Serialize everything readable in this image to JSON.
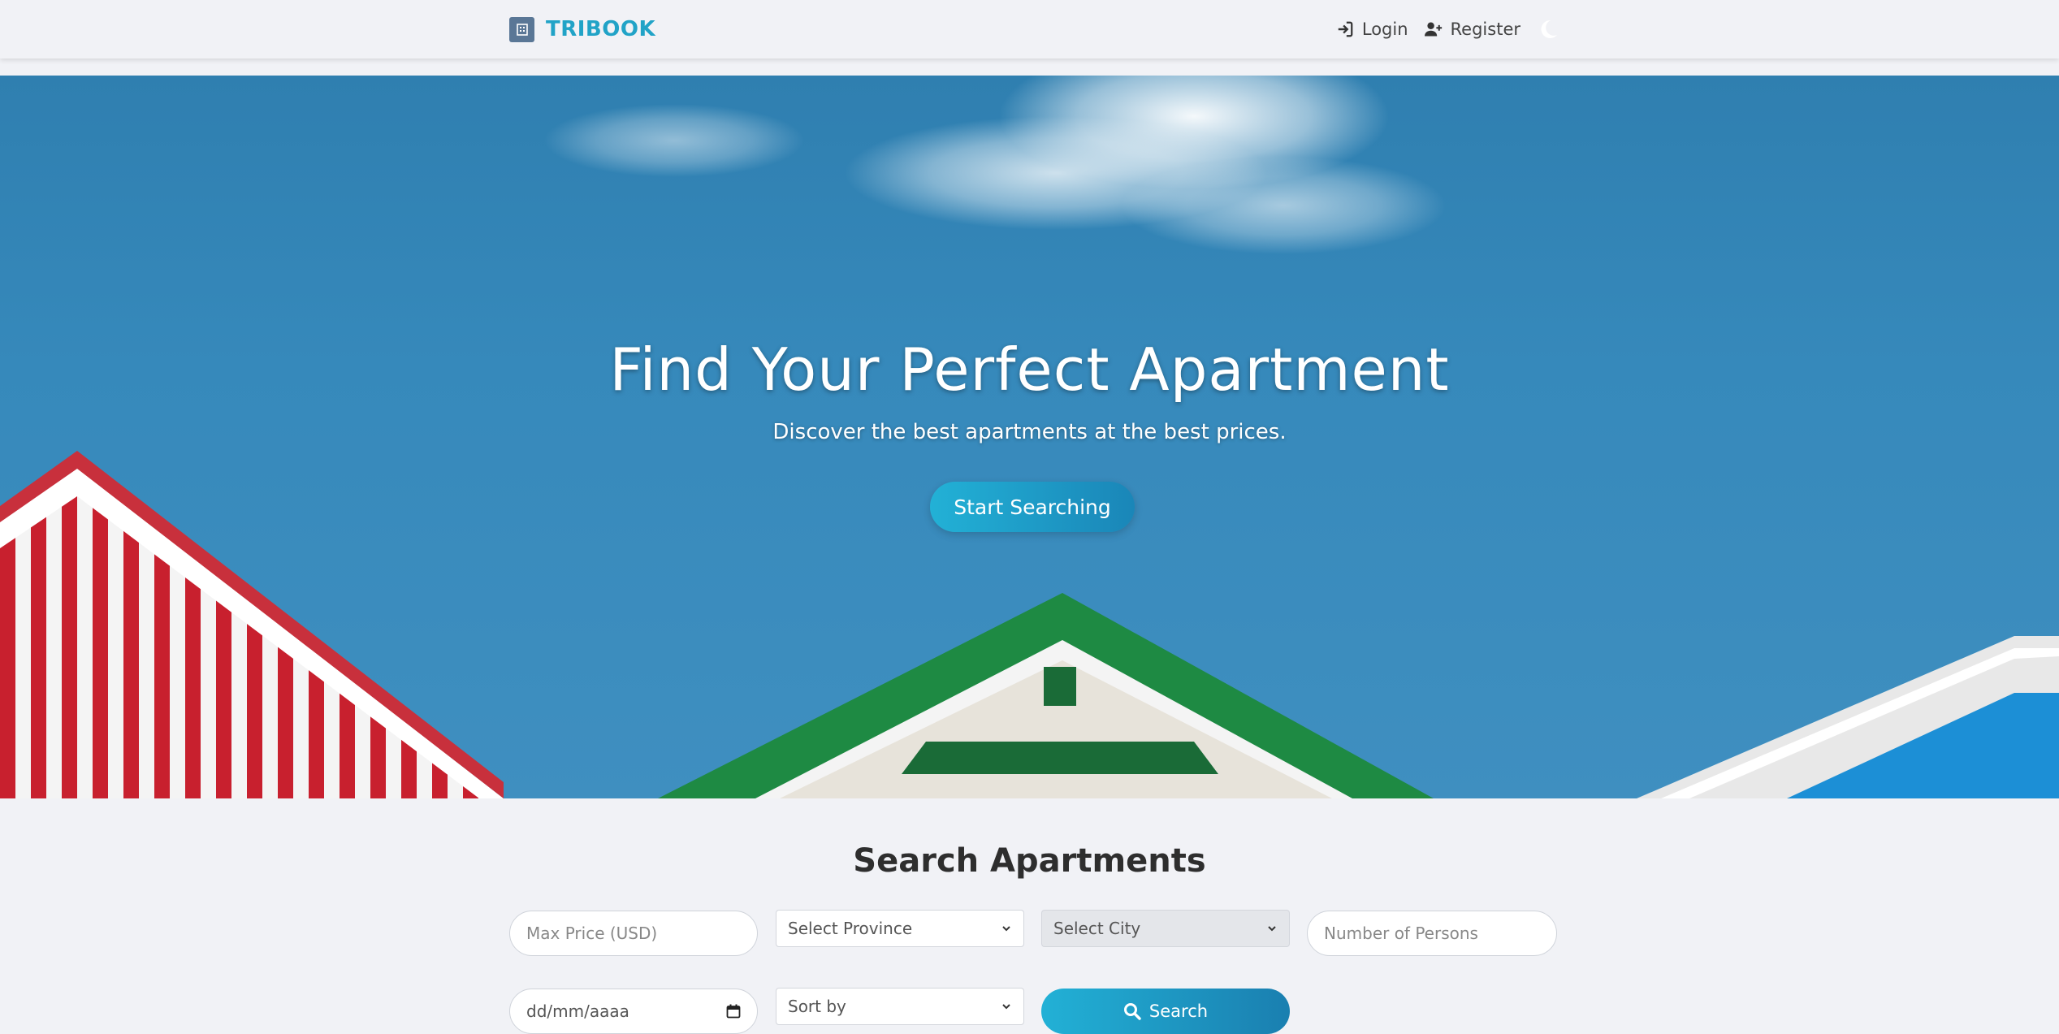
{
  "brand": {
    "name": "TRIBOOK",
    "logo_icon": "building-icon",
    "accent": "#21a3c7"
  },
  "nav": {
    "login_label": "Login",
    "register_label": "Register",
    "theme_icon": "moon-icon"
  },
  "hero": {
    "title": "Find Your Perfect Apartment",
    "subtitle": "Discover the best apartments at the best prices.",
    "cta_label": "Start Searching"
  },
  "search": {
    "title": "Search Apartments",
    "max_price_placeholder": "Max Price (USD)",
    "province_selected": "Select Province",
    "city_selected": "Select City",
    "persons_placeholder": "Number of Persons",
    "date_value": "dd/mm/aaaa",
    "sort_selected": "Sort by",
    "search_label": "Search"
  }
}
